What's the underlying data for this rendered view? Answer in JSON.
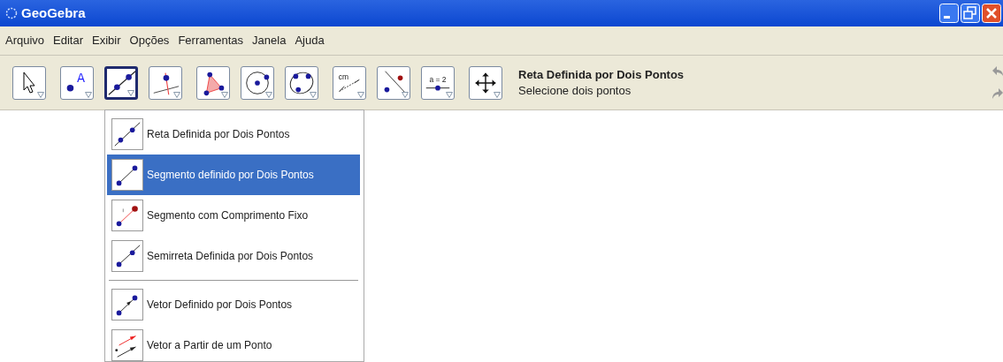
{
  "window": {
    "title": "GeoGebra"
  },
  "menu": [
    "Arquivo",
    "Editar",
    "Exibir",
    "Opções",
    "Ferramentas",
    "Janela",
    "Ajuda"
  ],
  "tool_groups": [
    [
      {
        "kind": "move",
        "selected": false
      }
    ],
    [
      {
        "kind": "point",
        "selected": false,
        "label": "A"
      },
      {
        "kind": "line",
        "selected": true
      },
      {
        "kind": "perpendicular",
        "selected": false
      }
    ],
    [
      {
        "kind": "polygon",
        "selected": false
      },
      {
        "kind": "circle",
        "selected": false
      },
      {
        "kind": "conic",
        "selected": false
      }
    ],
    [
      {
        "kind": "measure",
        "selected": false,
        "label": "cm"
      },
      {
        "kind": "reflect",
        "selected": false
      },
      {
        "kind": "slider",
        "selected": false,
        "label": "a = 2"
      }
    ],
    [
      {
        "kind": "pan",
        "selected": false
      }
    ]
  ],
  "tool_help": {
    "title": "Reta Definida por Dois Pontos",
    "hint": "Selecione dois pontos"
  },
  "dropdown": [
    {
      "label": "Reta Definida por Dois Pontos",
      "kind": "line",
      "selected": false,
      "separator_before": false
    },
    {
      "label": "Segmento definido por Dois Pontos",
      "kind": "segment",
      "selected": true,
      "separator_before": false
    },
    {
      "label": "Segmento com Comprimento Fixo",
      "kind": "fixed",
      "selected": false,
      "separator_before": false
    },
    {
      "label": "Semirreta Definida por Dois Pontos",
      "kind": "ray",
      "selected": false,
      "separator_before": false
    },
    {
      "label": "Vetor Definido por Dois Pontos",
      "kind": "vector",
      "selected": false,
      "separator_before": true
    },
    {
      "label": "Vetor a Partir de um Ponto",
      "kind": "vecfrom",
      "selected": false,
      "separator_before": false
    }
  ]
}
